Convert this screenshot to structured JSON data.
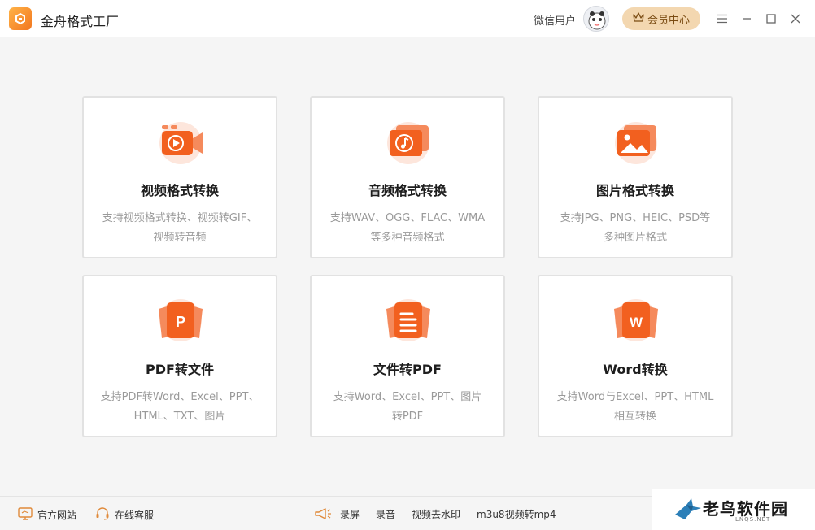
{
  "app": {
    "title": "金舟格式工厂",
    "user_name": "微信用户",
    "vip_label": "会员中心",
    "accent": "#f2761f",
    "vip_bg": "#f3d7b0"
  },
  "window_controls": [
    "menu-icon",
    "minimize-icon",
    "maximize-icon",
    "close-icon"
  ],
  "cards": [
    {
      "title": "视频格式转换",
      "desc1": "支持视频格式转换、视频转GIF、",
      "desc2": "视频转音频",
      "icon": "video-icon"
    },
    {
      "title": "音频格式转换",
      "desc1": "支持WAV、OGG、FLAC、WMA",
      "desc2": "等多种音频格式",
      "icon": "music-icon"
    },
    {
      "title": "图片格式转换",
      "desc1": "支持JPG、PNG、HEIC、PSD等",
      "desc2": "多种图片格式",
      "icon": "image-icon"
    },
    {
      "title": "PDF转文件",
      "desc1": "支持PDF转Word、Excel、PPT、",
      "desc2": "HTML、TXT、图片",
      "icon": "pdf-icon",
      "glyph": "P"
    },
    {
      "title": "文件转PDF",
      "desc1": "支持Word、Excel、PPT、图片",
      "desc2": "转PDF",
      "icon": "document-icon"
    },
    {
      "title": "Word转换",
      "desc1": "支持Word与Excel、PPT、HTML",
      "desc2": "相互转换",
      "icon": "word-icon",
      "glyph": "W"
    }
  ],
  "bottom": {
    "website": "官方网站",
    "support": "在线客服",
    "screen_record": "录屏",
    "audio_record": "录音",
    "watermark_remove": "视频去水印",
    "m3u8": "m3u8视频转mp4"
  },
  "watermark": {
    "text": "老鸟软件园",
    "sub": "LNQS.NET"
  }
}
